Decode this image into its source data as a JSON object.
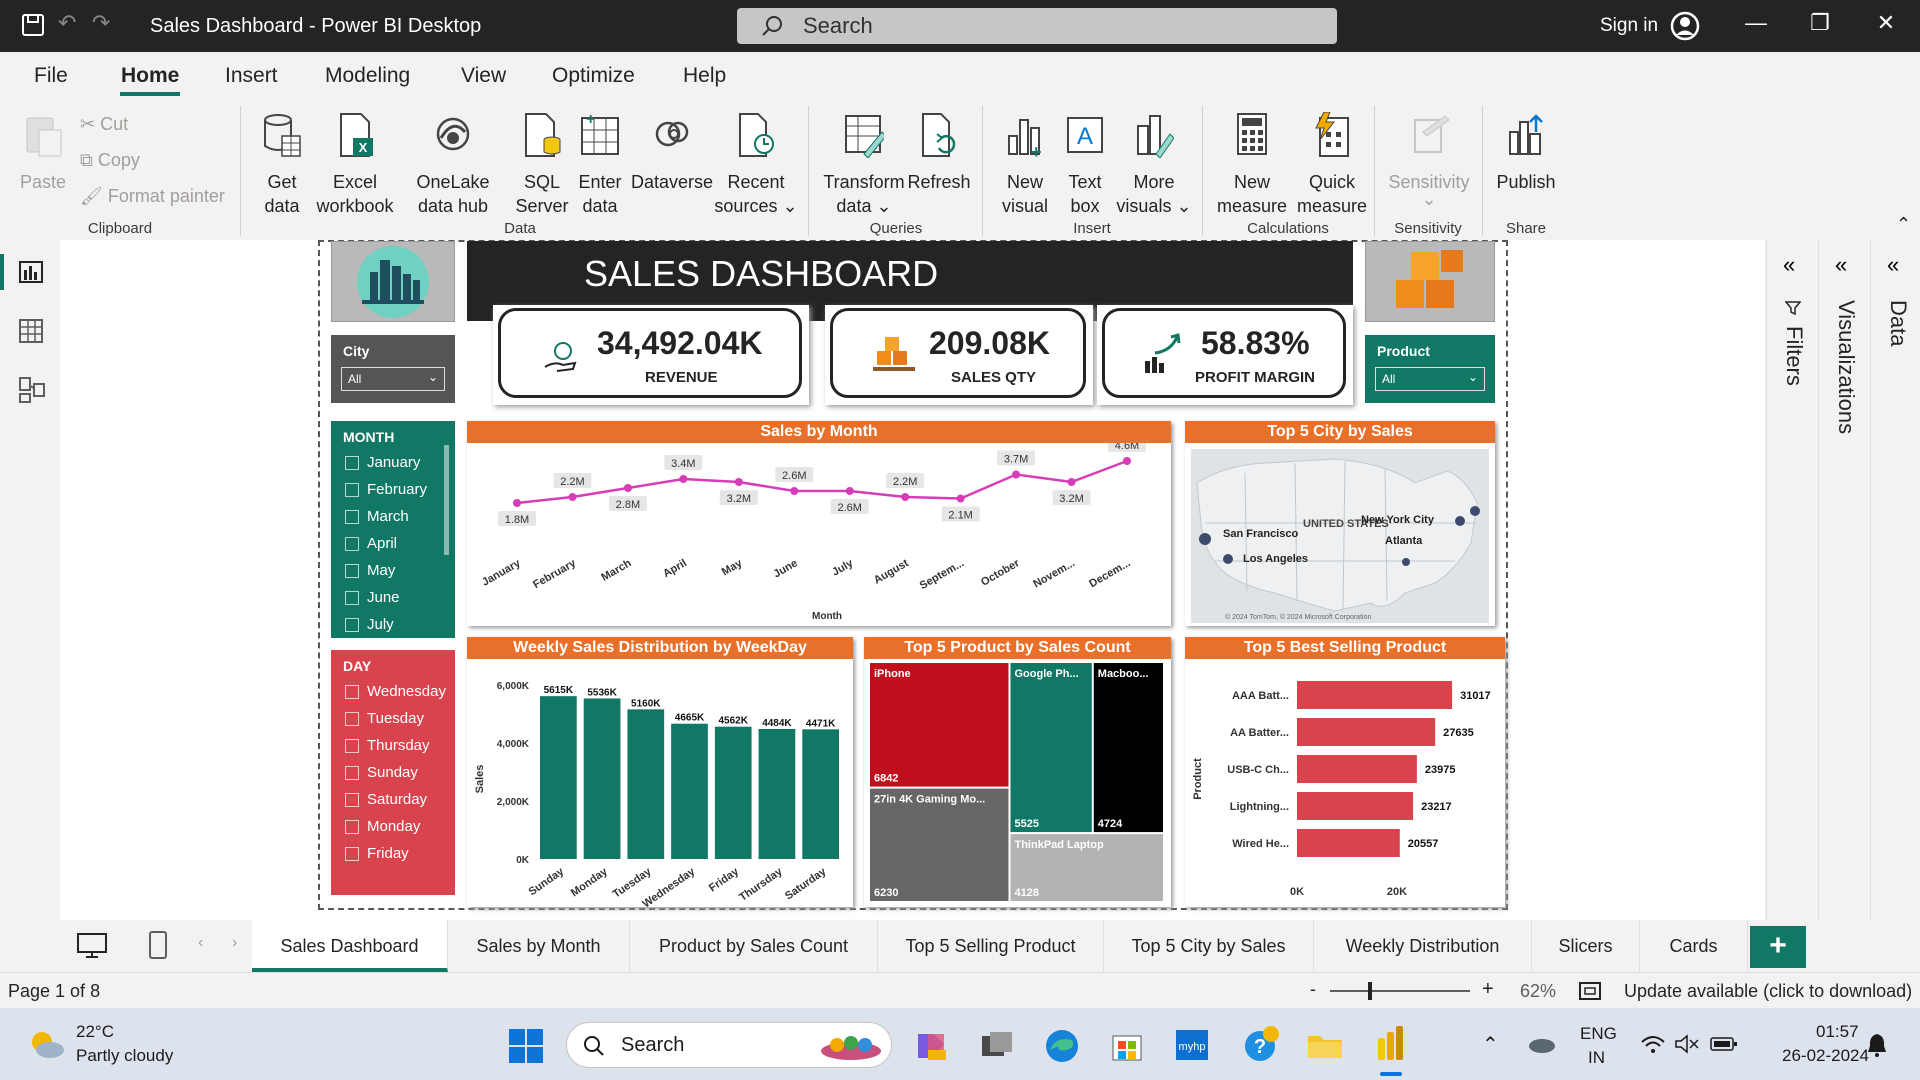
{
  "window": {
    "title": "Sales Dashboard - Power BI Desktop",
    "search_placeholder": "Search",
    "sign_in": "Sign in"
  },
  "menu": [
    "File",
    "Home",
    "Insert",
    "Modeling",
    "View",
    "Optimize",
    "Help"
  ],
  "ribbon": {
    "clipboard": {
      "paste": "Paste",
      "cut": "Cut",
      "copy": "Copy",
      "format_painter": "Format painter",
      "label": "Clipboard"
    },
    "data": {
      "get_data": "Get data",
      "excel": "Excel workbook",
      "onelake": "OneLake data hub",
      "sql": "SQL Server",
      "enter": "Enter data",
      "dataverse": "Dataverse",
      "recent": "Recent sources",
      "label": "Data"
    },
    "queries": {
      "transform": "Transform data",
      "refresh": "Refresh",
      "label": "Queries"
    },
    "insert": {
      "new_visual": "New visual",
      "text_box": "Text box",
      "more_visuals": "More visuals",
      "label": "Insert"
    },
    "calculations": {
      "new_measure": "New measure",
      "quick_measure": "Quick measure",
      "label": "Calculations"
    },
    "sensitivity": {
      "sensitivity": "Sensitivity",
      "label": "Sensitivity"
    },
    "share": {
      "publish": "Publish",
      "label": "Share"
    }
  },
  "panes": {
    "filters": "Filters",
    "visualizations": "Visualizations",
    "data": "Data"
  },
  "report": {
    "title": "SALES DASHBOARD",
    "city_slicer": {
      "label": "City",
      "value": "All"
    },
    "product_slicer": {
      "label": "Product",
      "value": "All"
    },
    "kpis": [
      {
        "value": "34,492.04K",
        "label": "REVENUE"
      },
      {
        "value": "209.08K",
        "label": "SALES QTY"
      },
      {
        "value": "58.83%",
        "label": "PROFIT MARGIN"
      }
    ],
    "month_slicer": {
      "label": "MONTH",
      "items": [
        "January",
        "February",
        "March",
        "April",
        "May",
        "June",
        "July"
      ]
    },
    "day_slicer": {
      "label": "DAY",
      "items": [
        "Wednesday",
        "Tuesday",
        "Thursday",
        "Sunday",
        "Saturday",
        "Monday",
        "Friday"
      ]
    },
    "map": {
      "title": "Top 5 City by Sales",
      "country_label": "UNITED STATES",
      "cities": [
        "San Francisco",
        "Los Angeles",
        "New York City",
        "Atlanta"
      ],
      "credits": "© 2024 TomTom, © 2024 Microsoft Corporation"
    }
  },
  "chart_data": [
    {
      "type": "line",
      "title": "Sales by Month",
      "xlabel": "Month",
      "categories": [
        "January",
        "February",
        "March",
        "April",
        "May",
        "June",
        "July",
        "August",
        "Septem...",
        "October",
        "Novem...",
        "Decem..."
      ],
      "values": [
        1.8,
        2.2,
        2.8,
        3.4,
        3.2,
        2.6,
        2.6,
        2.2,
        2.1,
        3.7,
        3.2,
        4.6
      ],
      "labels": [
        "1.8M",
        "2.2M",
        "2.8M",
        "3.4M",
        "3.2M",
        "2.6M",
        "2.6M",
        "2.2M",
        "2.1M",
        "3.7M",
        "3.2M",
        "4.6M"
      ],
      "color": "#d63cb7"
    },
    {
      "type": "bar",
      "title": "Weekly Sales Distribution by WeekDay",
      "ylabel": "Sales",
      "categories": [
        "Sunday",
        "Monday",
        "Tuesday",
        "Wednesday",
        "Friday",
        "Thursday",
        "Saturday"
      ],
      "values": [
        5615,
        5536,
        5160,
        4665,
        4562,
        4484,
        4471
      ],
      "labels": [
        "5615K",
        "5536K",
        "5160K",
        "4665K",
        "4562K",
        "4484K",
        "4471K"
      ],
      "yticks": [
        "0K",
        "2,000K",
        "4,000K",
        "6,000K"
      ],
      "ylim": [
        0,
        6000
      ],
      "color": "#117865"
    },
    {
      "type": "heatmap",
      "title": "Top 5 Product by Sales Count",
      "items": [
        {
          "name": "iPhone",
          "value": 6842,
          "color": "#c00f1c"
        },
        {
          "name": "27in 4K Gaming Mo...",
          "value": 6230,
          "color": "#666666"
        },
        {
          "name": "Google Ph...",
          "value": 5525,
          "color": "#117865"
        },
        {
          "name": "Macboo...",
          "value": 4724,
          "color": "#000000"
        },
        {
          "name": "ThinkPad Laptop",
          "value": 4128,
          "color": "#b3b3b3"
        }
      ]
    },
    {
      "type": "bar",
      "title": "Top 5 Best Selling Product",
      "ylabel": "Product",
      "categories": [
        "AAA Batt...",
        "AA Batter...",
        "USB-C Ch...",
        "Lightning...",
        "Wired He..."
      ],
      "values": [
        31017,
        27635,
        23975,
        23217,
        20557
      ],
      "xticks": [
        "0K",
        "20K"
      ],
      "xlim": [
        0,
        38000
      ],
      "color": "#d9434d"
    }
  ],
  "page_tabs": [
    "Sales Dashboard",
    "Sales by Month",
    "Product by Sales Count",
    "Top 5 Selling Product",
    "Top 5 City by Sales",
    "Weekly Distribution",
    "Slicers",
    "Cards"
  ],
  "status": {
    "page": "Page 1 of 8",
    "zoom": "62%",
    "update": "Update available (click to download)"
  },
  "taskbar": {
    "temp": "22°C",
    "weather": "Partly cloudy",
    "search": "Search",
    "lang1": "ENG",
    "lang2": "IN",
    "time": "01:57",
    "date": "26-02-2024"
  }
}
